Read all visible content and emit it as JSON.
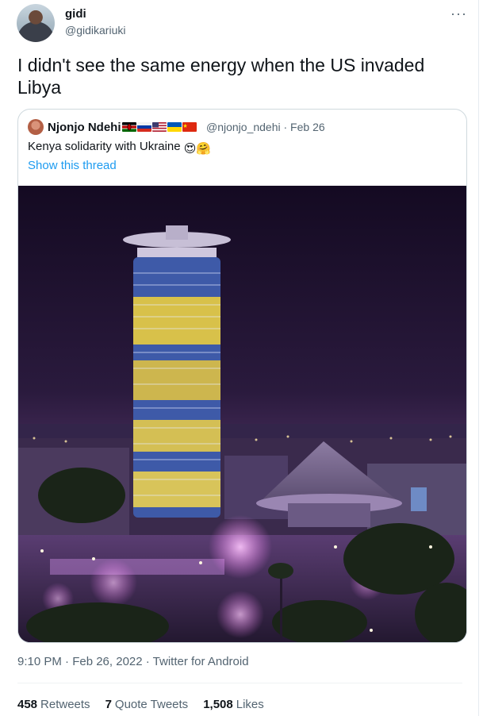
{
  "tweet": {
    "author_name": "gidi",
    "author_handle": "@gidikariuki",
    "more_icon": "more-dots-icon",
    "text": "I didn't see the same energy when the US invaded Libya",
    "timestamp": "9:10 PM · Feb 26, 2022 · ",
    "source": "Twitter for Android"
  },
  "quote": {
    "author_name": "Njonjo Ndehi",
    "flags": [
      "kenya",
      "russia",
      "usa",
      "ukraine",
      "china"
    ],
    "handle_date": "@njonjo_ndehi · Feb 26",
    "text": "Kenya solidarity with Ukraine",
    "emojis": "😍🤗",
    "show_thread": "Show this thread"
  },
  "stats": {
    "retweets_count": "458",
    "retweets_label": "Retweets",
    "quotes_count": "7",
    "quotes_label": "Quote Tweets",
    "likes_count": "1,508",
    "likes_label": "Likes"
  },
  "colors": {
    "link": "#1d9bf0",
    "secondary_text": "#536471",
    "border": "#cfd9de"
  }
}
